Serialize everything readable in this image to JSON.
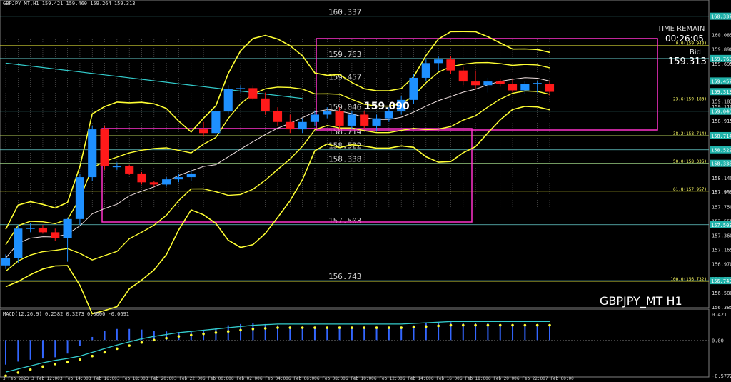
{
  "header": {
    "symbol_line": "GBPJPY_MT,H1  159.421 159.460 159.264 159.313",
    "watermark": "GBPJPY_MT H1",
    "time_remain_label": "TIME REMAIN",
    "time_remain_value": "00:26:05",
    "bid_label": "Bid",
    "bid_value": "159.313",
    "big_price": "159.090"
  },
  "colors": {
    "background": "#000000",
    "bull_candle": "#1e90ff",
    "bear_candle": "#ff1a1a",
    "bollinger": "#ffff33",
    "box": "#ff33cc",
    "level_line": "#ffff66",
    "cyan_line": "#33cccc",
    "macd_line": "#33cccc",
    "signal_dots": "#ffff33"
  },
  "levels": [
    {
      "label": "160.337",
      "value": 160.337
    },
    {
      "label": "159.763",
      "value": 159.763
    },
    {
      "label": "159.457",
      "value": 159.457
    },
    {
      "label": "159.046",
      "value": 159.046
    },
    {
      "label": "158.714",
      "value": 158.714
    },
    {
      "label": "158.522",
      "value": 158.522
    },
    {
      "label": "158.338",
      "value": 158.338
    },
    {
      "label": "157.503",
      "value": 157.503
    },
    {
      "label": "156.743",
      "value": 156.743
    }
  ],
  "fib_labels": [
    {
      "label": "23.6(159.183)",
      "value": 159.183
    },
    {
      "label": "38.2(158.714)",
      "value": 158.714
    },
    {
      "label": "50.0(158.336)",
      "value": 158.336
    },
    {
      "label": "61.8(157.957)",
      "value": 157.957
    },
    {
      "label": "100.0(156.732)",
      "value": 156.732
    },
    {
      "label": "0.0(159.940)",
      "value": 159.94
    }
  ],
  "price_axis": [
    "160.337",
    "160.085",
    "159.890",
    "159.763",
    "159.695",
    "159.457",
    "159.313",
    "159.183",
    "159.110",
    "159.046",
    "158.915",
    "158.714",
    "158.720",
    "158.522",
    "158.338",
    "158.335",
    "158.140",
    "157.957",
    "157.945",
    "157.750",
    "157.555",
    "157.503",
    "157.360",
    "157.165",
    "156.970",
    "156.743",
    "156.775",
    "156.580",
    "156.385"
  ],
  "price_axis_tagged": [
    "160.337",
    "159.763",
    "159.457",
    "159.313",
    "159.046",
    "158.714",
    "158.522",
    "158.338",
    "157.503",
    "156.743"
  ],
  "time_axis": [
    "3 Feb 2023",
    "3 Feb 12:00",
    "3 Feb 14:00",
    "3 Feb 16:00",
    "3 Feb 18:00",
    "3 Feb 20:00",
    "3 Feb 22:00",
    "6 Feb 00:00",
    "6 Feb 02:00",
    "6 Feb 04:00",
    "6 Feb 06:00",
    "6 Feb 08:00",
    "6 Feb 10:00",
    "6 Feb 12:00",
    "6 Feb 14:00",
    "6 Feb 16:00",
    "6 Feb 18:00",
    "6 Feb 20:00",
    "6 Feb 22:00",
    "7 Feb 00:00"
  ],
  "macd": {
    "label": "MACD(12,26,9) 0.2582 0.3273 0.0000 -0.0691",
    "axis": [
      "0.421",
      "0.00",
      "-0.5772"
    ],
    "axis_values": [
      0.421,
      0.0,
      -0.5772
    ]
  },
  "chart_data": {
    "type": "candlestick",
    "price_range": [
      156.385,
      160.46
    ],
    "candles": [
      {
        "o": 156.95,
        "h": 157.1,
        "l": 156.9,
        "c": 157.05
      },
      {
        "o": 157.05,
        "h": 157.5,
        "l": 156.98,
        "c": 157.45
      },
      {
        "o": 157.45,
        "h": 157.52,
        "l": 157.4,
        "c": 157.46
      },
      {
        "o": 157.46,
        "h": 157.5,
        "l": 157.38,
        "c": 157.4
      },
      {
        "o": 157.4,
        "h": 157.45,
        "l": 157.28,
        "c": 157.32
      },
      {
        "o": 157.32,
        "h": 157.6,
        "l": 157.0,
        "c": 157.58
      },
      {
        "o": 157.58,
        "h": 158.2,
        "l": 157.5,
        "c": 158.15
      },
      {
        "o": 158.15,
        "h": 158.85,
        "l": 158.1,
        "c": 158.8
      },
      {
        "o": 158.8,
        "h": 158.85,
        "l": 158.25,
        "c": 158.3
      },
      {
        "o": 158.3,
        "h": 158.35,
        "l": 158.25,
        "c": 158.3
      },
      {
        "o": 158.3,
        "h": 158.32,
        "l": 158.18,
        "c": 158.2
      },
      {
        "o": 158.2,
        "h": 158.22,
        "l": 158.05,
        "c": 158.08
      },
      {
        "o": 158.08,
        "h": 158.1,
        "l": 158.02,
        "c": 158.05
      },
      {
        "o": 158.05,
        "h": 158.15,
        "l": 158.02,
        "c": 158.12
      },
      {
        "o": 158.12,
        "h": 158.2,
        "l": 158.08,
        "c": 158.15
      },
      {
        "o": 158.15,
        "h": 158.25,
        "l": 158.1,
        "c": 158.2
      },
      {
        "o": 158.8,
        "h": 158.9,
        "l": 158.7,
        "c": 158.75
      },
      {
        "o": 158.75,
        "h": 159.1,
        "l": 158.7,
        "c": 159.05
      },
      {
        "o": 159.05,
        "h": 159.4,
        "l": 159.0,
        "c": 159.35
      },
      {
        "o": 159.35,
        "h": 159.4,
        "l": 159.3,
        "c": 159.36
      },
      {
        "o": 159.36,
        "h": 159.4,
        "l": 159.2,
        "c": 159.22
      },
      {
        "o": 159.22,
        "h": 159.3,
        "l": 159.0,
        "c": 159.05
      },
      {
        "o": 159.05,
        "h": 159.1,
        "l": 158.85,
        "c": 158.9
      },
      {
        "o": 158.9,
        "h": 159.0,
        "l": 158.75,
        "c": 158.8
      },
      {
        "o": 158.8,
        "h": 158.95,
        "l": 158.75,
        "c": 158.9
      },
      {
        "o": 158.9,
        "h": 159.05,
        "l": 158.85,
        "c": 159.0
      },
      {
        "o": 159.0,
        "h": 159.1,
        "l": 158.95,
        "c": 159.05
      },
      {
        "o": 159.05,
        "h": 159.1,
        "l": 158.8,
        "c": 158.85
      },
      {
        "o": 158.85,
        "h": 159.05,
        "l": 158.8,
        "c": 159.0
      },
      {
        "o": 159.0,
        "h": 159.05,
        "l": 158.8,
        "c": 158.85
      },
      {
        "o": 158.85,
        "h": 159.0,
        "l": 158.78,
        "c": 158.95
      },
      {
        "o": 158.95,
        "h": 159.1,
        "l": 158.9,
        "c": 159.05
      },
      {
        "o": 159.05,
        "h": 159.25,
        "l": 159.0,
        "c": 159.2
      },
      {
        "o": 159.2,
        "h": 159.55,
        "l": 159.15,
        "c": 159.5
      },
      {
        "o": 159.5,
        "h": 159.75,
        "l": 159.45,
        "c": 159.7
      },
      {
        "o": 159.7,
        "h": 159.8,
        "l": 159.6,
        "c": 159.75
      },
      {
        "o": 159.75,
        "h": 159.8,
        "l": 159.55,
        "c": 159.6
      },
      {
        "o": 159.6,
        "h": 159.65,
        "l": 159.4,
        "c": 159.45
      },
      {
        "o": 159.45,
        "h": 159.6,
        "l": 159.35,
        "c": 159.4
      },
      {
        "o": 159.4,
        "h": 159.5,
        "l": 159.3,
        "c": 159.45
      },
      {
        "o": 159.45,
        "h": 159.48,
        "l": 159.38,
        "c": 159.42
      },
      {
        "o": 159.42,
        "h": 159.48,
        "l": 159.3,
        "c": 159.33
      },
      {
        "o": 159.33,
        "h": 159.45,
        "l": 159.28,
        "c": 159.42
      },
      {
        "o": 159.42,
        "h": 159.45,
        "l": 159.3,
        "c": 159.43
      },
      {
        "o": 159.42,
        "h": 159.46,
        "l": 159.26,
        "c": 159.31
      }
    ],
    "macd_histogram": [
      -0.4,
      -0.35,
      -0.32,
      -0.3,
      -0.28,
      -0.22,
      -0.1,
      0.05,
      0.15,
      0.18,
      0.18,
      0.17,
      0.15,
      0.14,
      0.13,
      0.13,
      0.16,
      0.2,
      0.24,
      0.26,
      0.27,
      0.26,
      0.24,
      0.22,
      0.21,
      0.21,
      0.21,
      0.2,
      0.2,
      0.19,
      0.19,
      0.2,
      0.22,
      0.24,
      0.27,
      0.29,
      0.29,
      0.28,
      0.27,
      0.27,
      0.26,
      0.26,
      0.25,
      0.24,
      0.26
    ],
    "macd_signal": [
      -0.52,
      -0.47,
      -0.42,
      -0.37,
      -0.33,
      -0.3,
      -0.26,
      -0.2,
      -0.14,
      -0.08,
      -0.03,
      0.02,
      0.06,
      0.09,
      0.12,
      0.14,
      0.16,
      0.18,
      0.2,
      0.22,
      0.24,
      0.25,
      0.26,
      0.26,
      0.26,
      0.26,
      0.26,
      0.26,
      0.26,
      0.26,
      0.26,
      0.26,
      0.26,
      0.27,
      0.28,
      0.29,
      0.3,
      0.3,
      0.3,
      0.3,
      0.3,
      0.3,
      0.3,
      0.3,
      0.3
    ]
  }
}
